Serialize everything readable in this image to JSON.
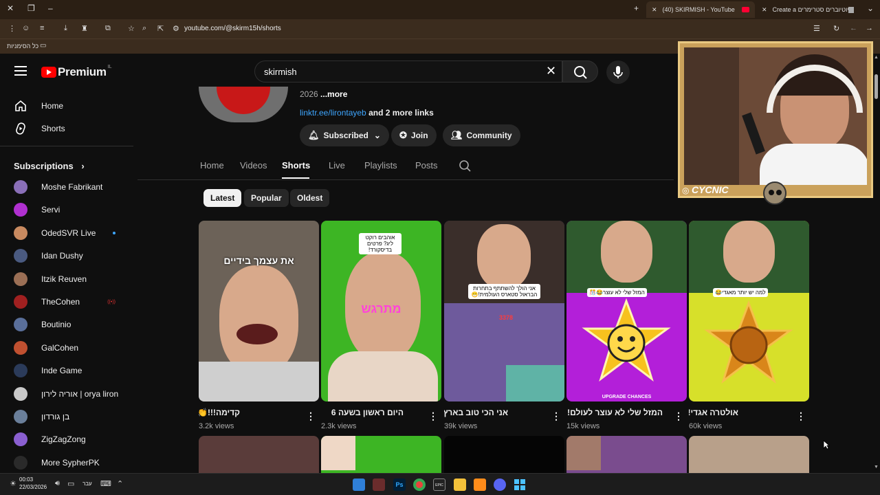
{
  "browser": {
    "tabs": [
      {
        "label": "(40) SKIRMISH - YouTube",
        "active": true
      },
      {
        "label": "Create a יוטיוברים סטרימרים",
        "active": false
      }
    ],
    "url": "youtube.com/@skirm15h/shorts",
    "bookmarks_label": "כל הסימניות"
  },
  "youtube": {
    "logo": "Premium",
    "country_code": "IL",
    "search_value": "skirmish",
    "sidebar": {
      "nav": [
        {
          "label": "Home",
          "icon": "home-icon"
        },
        {
          "label": "Shorts",
          "icon": "shorts-icon"
        }
      ],
      "subscriptions_label": "Subscriptions",
      "subscriptions": [
        {
          "name": "Moshe Fabrikant",
          "color": "#8a6fb8"
        },
        {
          "name": "Servi",
          "color": "#b030d0"
        },
        {
          "name": "OdedSVR Live",
          "color": "#c88a60",
          "dot": true
        },
        {
          "name": "Idan Dushy",
          "color": "#4a5a80"
        },
        {
          "name": "Itzik Reuven",
          "color": "#9b6f55"
        },
        {
          "name": "TheCohen",
          "color": "#a02020",
          "live": true
        },
        {
          "name": "Boutinio",
          "color": "#5a6f9a"
        },
        {
          "name": "GalCohen",
          "color": "#c05030"
        },
        {
          "name": "Inde Game",
          "color": "#2b3b5a"
        },
        {
          "name": "אוריה לירון | orya liron",
          "color": "#c9c9c9"
        },
        {
          "name": "בן גורדון",
          "color": "#6a7f9a"
        },
        {
          "name": "ZigZagZong",
          "color": "#8a5fd0"
        },
        {
          "name": "More SypherPK",
          "color": "#2a2a2a"
        }
      ]
    },
    "channel": {
      "description_tail": "2026",
      "more_label": "...more",
      "link": "linktr.ee/lirontayeb",
      "more_links": "and 2 more links",
      "subscribed_label": "Subscribed",
      "join_label": "Join",
      "community_label": "Community",
      "tabs": [
        "Home",
        "Videos",
        "Shorts",
        "Live",
        "Playlists",
        "Posts"
      ],
      "active_tab": "Shorts",
      "chips": [
        "Latest",
        "Popular",
        "Oldest"
      ],
      "active_chip": "Latest"
    },
    "shorts": [
      {
        "title": "קדימה!!!👏",
        "views": "3.2k views",
        "overlay": "את עצמך בידיים"
      },
      {
        "title": "היום ראשון בשעה 6",
        "views": "2.3k views",
        "overlay": "מתרגש",
        "bubble": "אוהבים רוקט ליג? פרטים בדיסקורד!"
      },
      {
        "title": "אני הכי טוב בארץ!",
        "views": "39k views",
        "bubble": "אני הולך להשתתף בתחרות הבראול סטארס העולמית!😁",
        "score": "3378"
      },
      {
        "title": "המזל שלי לא עוצר לעולם!!!",
        "views": "15k views",
        "bubble": "המזל שלי לא עוצר😂🎊",
        "banner": "UPGRADE CHANCES"
      },
      {
        "title": "אולטרה אגדי!",
        "views": "60k views",
        "bubble": "למה יש יותר מאגדי😂"
      }
    ]
  },
  "overlay": {
    "streamer_name": "CYCNIC"
  },
  "taskbar": {
    "time": "00:03",
    "date": "22/03/2026",
    "lang": "עבר"
  },
  "colors": {
    "yt_red": "#ff0000",
    "bg": "#0f0f0f",
    "chrome_bg": "#3b2c1e"
  }
}
